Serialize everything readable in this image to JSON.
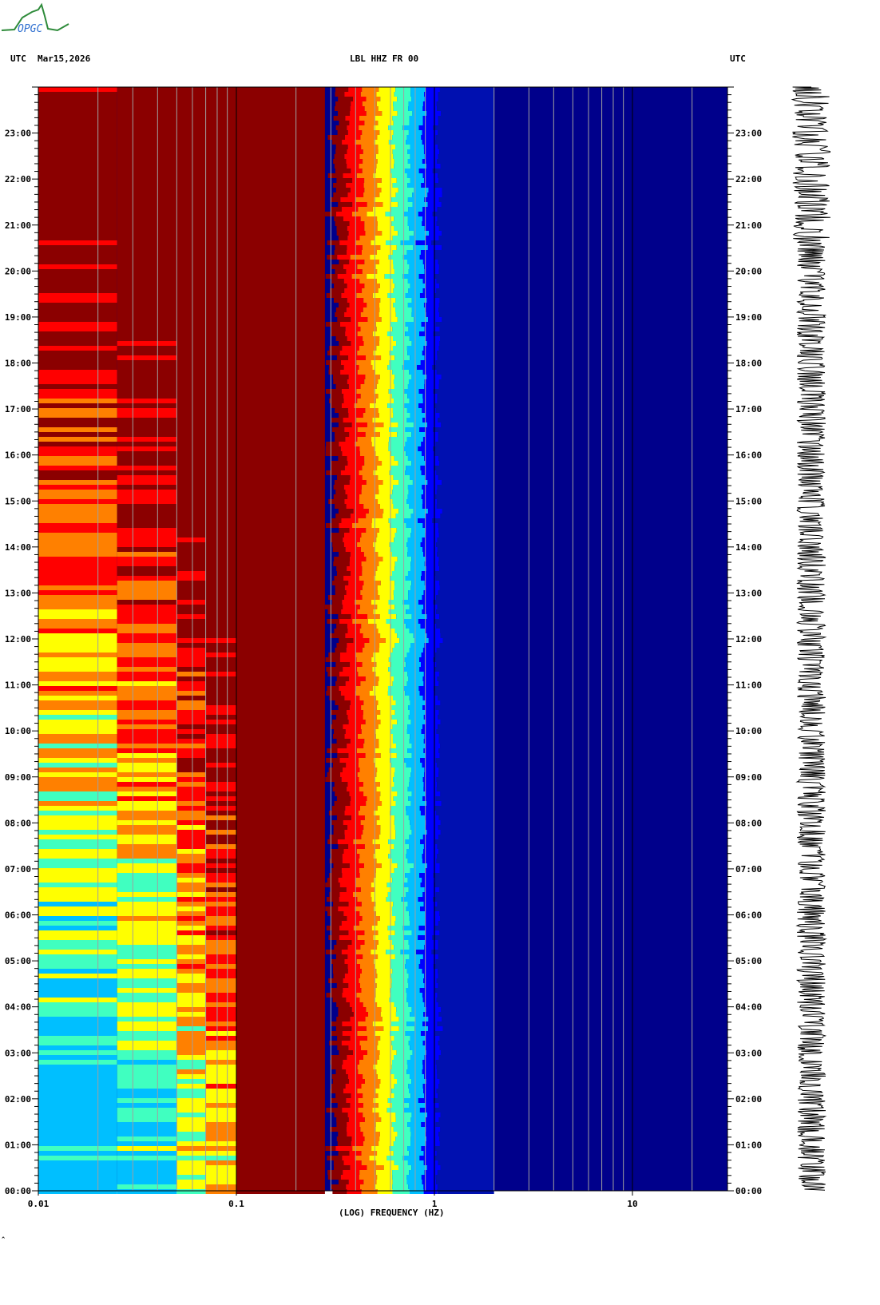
{
  "logo": {
    "text": "OPGC"
  },
  "header": {
    "left_tz": "UTC",
    "date": "Mar15,2026",
    "station": "LBL HHZ FR 00",
    "right_tz": "UTC"
  },
  "chart_data": {
    "type": "heatmap",
    "xlabel": "(LOG) FREQUENCY (HZ)",
    "xscale": "log",
    "xlim": [
      0.01,
      30
    ],
    "x_tick_labels": [
      "0.01",
      "0.1",
      "1",
      "10"
    ],
    "y_tick_labels": [
      "00:00",
      "01:00",
      "02:00",
      "03:00",
      "04:00",
      "05:00",
      "06:00",
      "07:00",
      "08:00",
      "09:00",
      "10:00",
      "11:00",
      "12:00",
      "13:00",
      "14:00",
      "15:00",
      "16:00",
      "17:00",
      "18:00",
      "19:00",
      "20:00",
      "21:00",
      "22:00",
      "23:00"
    ],
    "ylim_hours": [
      0,
      24
    ],
    "colormap": [
      "#00008b",
      "#0000ff",
      "#00bfff",
      "#40ffc0",
      "#ffff00",
      "#ff8000",
      "#ff0000",
      "#8b0000"
    ],
    "side_panel": "seismogram trace"
  },
  "footer": {
    "mark": "^"
  }
}
